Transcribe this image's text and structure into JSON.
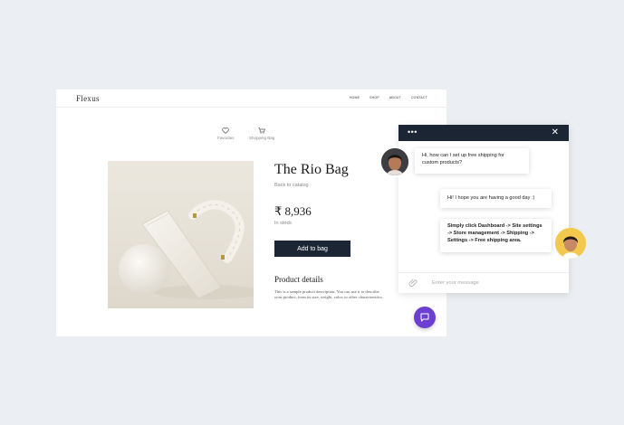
{
  "store": {
    "logo": "Flexus",
    "nav": [
      "HOME",
      "SHOP",
      "ABOUT",
      "CONTACT"
    ],
    "favorites_label": "Favorites",
    "shopping_bag_label": "Shopping Bag",
    "product": {
      "title": "The Rio Bag",
      "back_link": "Back to catalog",
      "price": "₹ 8,936",
      "stock": "In stock",
      "add_button": "Add to bag",
      "details_title": "Product details",
      "details_text": "This is a sample product description. You can use it to describe your product, from its size, weight, color, to other characteristics."
    }
  },
  "chat": {
    "header_menu": "•••",
    "close": "✕",
    "messages": [
      {
        "from": "user",
        "text": "Hi, how can I set up free shipping for custom products?"
      },
      {
        "from": "agent",
        "text": "Hi! I hope you are having a good day :)"
      },
      {
        "from": "agent",
        "text": "Simply click Dashboard -> Site settings -> Store management -> Shipping -> Settings -> Free shipping area."
      }
    ],
    "input_placeholder": "Enter your message"
  },
  "colors": {
    "background": "#ebeef2",
    "header_dark": "#1c2533",
    "launcher": "#6d3fd0",
    "agent_avatar_bg": "#f2c94c"
  },
  "icons": {
    "favorites": "heart-icon",
    "bag": "shopping-bag-icon",
    "attach": "paperclip-icon",
    "launcher": "chat-bubble-icon"
  }
}
